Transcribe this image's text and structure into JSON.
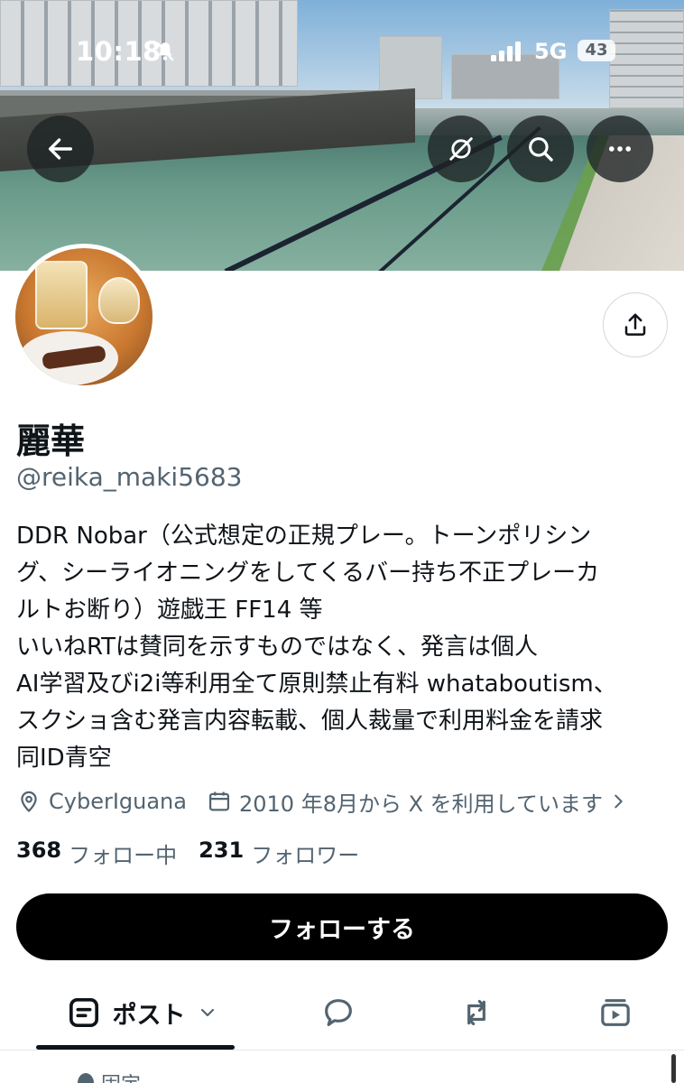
{
  "status_bar": {
    "time": "10:18",
    "network": "5G",
    "battery": "43"
  },
  "banner": {
    "buttons": [
      "back-arrow-icon",
      "hide-icon",
      "search-icon",
      "more-icon"
    ]
  },
  "profile": {
    "name": "麗華",
    "handle": "@reika_maki5683",
    "bio": [
      "DDR Nobar（公式想定の正規プレー。トーンポリシン",
      "グ、シーライオニングをしてくるバー持ち不正プレーカ",
      "ルトお断り）遊戯王 FF14 等",
      "いいねRTは賛同を示すものではなく、発言は個人",
      "AI学習及びi2i等利用全て原則禁止有料 whataboutism、",
      "スクショ含む発言内容転載、個人裁量で利用料金を請求",
      "同ID青空"
    ],
    "location": "CyberIguana",
    "joined": "2010 年8月から X を利用しています",
    "following_count": "368",
    "following_label": "フォロー中",
    "followers_count": "231",
    "followers_label": "フォロワー",
    "follow_button": "フォローする"
  },
  "tabs": {
    "posts_label": "ポスト"
  },
  "pinned_label": "固定",
  "colors": {
    "text": "#0f1419",
    "secondary": "#536471",
    "button_bg": "#000000"
  }
}
